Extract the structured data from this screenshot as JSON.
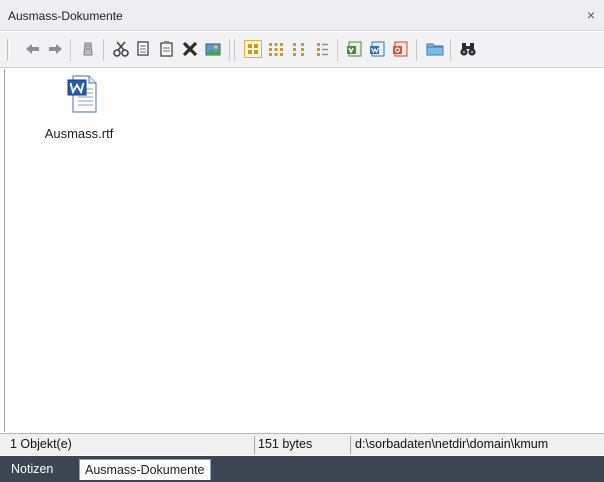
{
  "window": {
    "title": "Ausmass-Dokumente",
    "close_glyph": "×"
  },
  "toolbar": {
    "buttons": [
      {
        "name": "back-icon"
      },
      {
        "name": "forward-icon"
      },
      {
        "name": "undo-icon"
      },
      {
        "name": "cut-icon"
      },
      {
        "name": "copy-icon"
      },
      {
        "name": "paste-icon"
      },
      {
        "name": "delete-icon"
      },
      {
        "name": "properties-icon"
      },
      {
        "name": "large-icons-view-icon"
      },
      {
        "name": "small-icons-view-icon"
      },
      {
        "name": "list-view-icon"
      },
      {
        "name": "details-view-icon"
      },
      {
        "name": "word-document-icon"
      },
      {
        "name": "excel-document-icon"
      },
      {
        "name": "other-document-icon"
      },
      {
        "name": "folder-icon"
      },
      {
        "name": "search-binoculars-icon"
      }
    ]
  },
  "files": [
    {
      "name": "Ausmass.rtf",
      "icon": "word-document-icon"
    }
  ],
  "status": {
    "count": "1 Objekt(e)",
    "size": "151 bytes",
    "path": "d:\\sorbadaten\\netdir\\domain\\kmum"
  },
  "tabs": [
    {
      "label": "Notizen",
      "active": false
    },
    {
      "label": "Ausmass-Dokumente",
      "active": true
    }
  ],
  "colors": {
    "tab_strip": "#3c4653",
    "toolbar": "#f2f2f4",
    "title_bar": "#eeeef2"
  }
}
